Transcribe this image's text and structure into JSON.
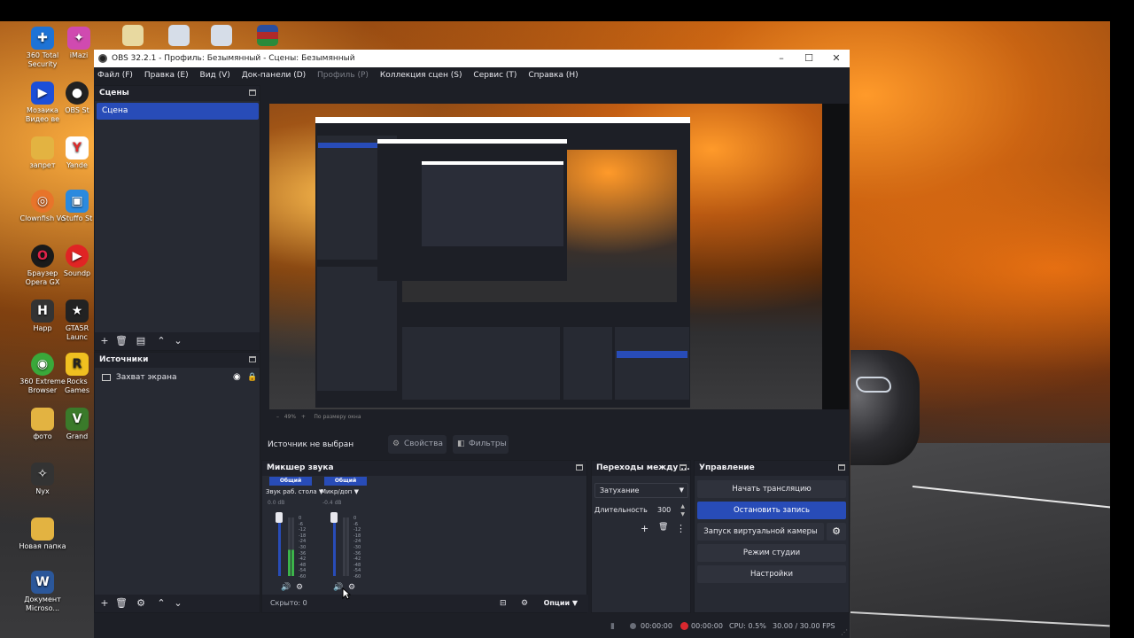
{
  "window": {
    "title": "OBS 32.2.1 - Профиль: Безымянный - Сцены: Безымянный",
    "minimize": "–",
    "maximize": "☐",
    "close": "✕"
  },
  "menu": {
    "items": [
      "Файл (F)",
      "Правка (E)",
      "Вид (V)",
      "Док-панели (D)",
      "Профиль (P)",
      "Коллекция сцен (S)",
      "Сервис (T)",
      "Справка (H)"
    ]
  },
  "scenes": {
    "title": "Сцены",
    "items": [
      "Сцена"
    ]
  },
  "sources": {
    "title": "Источники",
    "items": [
      "Захват экрана"
    ]
  },
  "context": {
    "no_source": "Источник не выбран",
    "properties": "Свойства",
    "filters": "Фильтры"
  },
  "mixer": {
    "title": "Микшер звука",
    "channels": [
      {
        "badge": "Общий",
        "name": "Звук раб. стола",
        "db": "0.0 dB"
      },
      {
        "badge": "Общий",
        "name": "Микр/доп",
        "db": "-0.4 dB"
      }
    ],
    "scale": [
      "0",
      "-6",
      "-12",
      "-18",
      "-24",
      "-30",
      "-36",
      "-42",
      "-48",
      "-54",
      "-60"
    ],
    "hidden": "Скрыто: 0",
    "options": "Опции"
  },
  "transitions": {
    "title": "Переходы между ...",
    "selected": "Затухание",
    "duration_label": "Длительность",
    "duration_value": "300"
  },
  "controls": {
    "title": "Управление",
    "start_stream": "Начать трансляцию",
    "stop_record": "Остановить запись",
    "virtual_cam": "Запуск виртуальной камеры",
    "studio_mode": "Режим студии",
    "settings": "Настройки"
  },
  "status": {
    "live_time": "00:00:00",
    "rec_time": "00:00:00",
    "cpu": "CPU: 0.5%",
    "fps": "30.00 / 30.00 FPS"
  },
  "preview_status": {
    "zoom": "49%",
    "fit": "По размеру окна"
  },
  "desktop_icons": [
    {
      "label": "360 Total Security",
      "icon": "shield-icon",
      "color": "#1e73d6"
    },
    {
      "label": "iMazi",
      "icon": "app-icon",
      "color": "#d04ab0"
    },
    {
      "label": "OBS St",
      "icon": "obs-icon",
      "color": "#222"
    },
    {
      "label": "Мозаика Видео ве",
      "icon": "video-icon",
      "color": "#1c4fd8"
    },
    {
      "label": "запрет",
      "icon": "folder-icon",
      "color": "#e3b341"
    },
    {
      "label": "Yande",
      "icon": "yandex-icon",
      "color": "#e02b2b"
    },
    {
      "label": "Clownfish Vo",
      "icon": "clownfish-icon",
      "color": "#e8742a"
    },
    {
      "label": "Stuffo St",
      "icon": "app-icon",
      "color": "#2a8adf"
    },
    {
      "label": "Браузер Opera GX",
      "icon": "opera-icon",
      "color": "#e0234a"
    },
    {
      "label": "Soundp",
      "icon": "play-icon",
      "color": "#e02424"
    },
    {
      "label": "Happ",
      "icon": "happ-icon",
      "color": "#333"
    },
    {
      "label": "GTA5R Launc",
      "icon": "gta-icon",
      "color": "#222"
    },
    {
      "label": "360 Extreme Browser",
      "icon": "browser-icon",
      "color": "#3aa83a"
    },
    {
      "label": "Rocks Games",
      "icon": "rockstar-icon",
      "color": "#f0c020"
    },
    {
      "label": "фото",
      "icon": "folder-icon",
      "color": "#e3b341"
    },
    {
      "label": "Grand",
      "icon": "gta-icon",
      "color": "#3a7a2a"
    },
    {
      "label": "Nyx",
      "icon": "nyx-icon",
      "color": "#333"
    },
    {
      "label": "Новая папка",
      "icon": "folder-icon",
      "color": "#e3b341"
    },
    {
      "label": "Документ Microso...",
      "icon": "word-icon",
      "color": "#2b579a"
    }
  ]
}
